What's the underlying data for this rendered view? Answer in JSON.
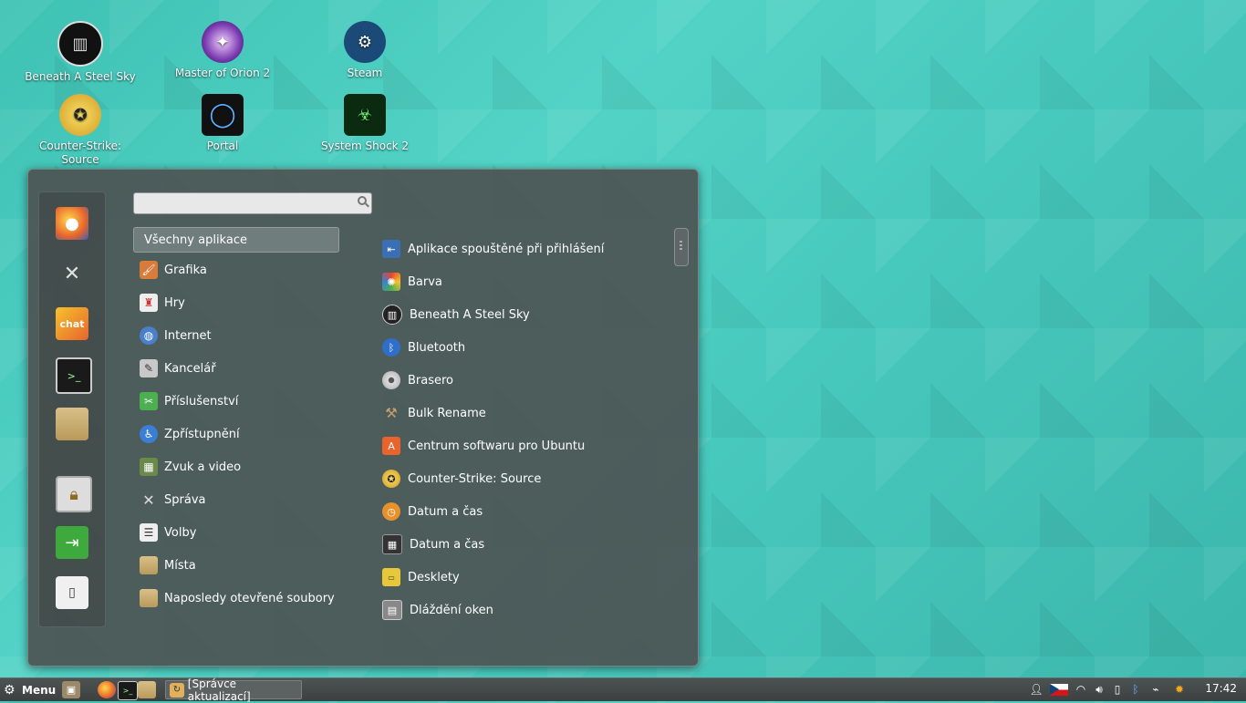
{
  "desktop_icons": [
    {
      "label": "Beneath A Steel Sky",
      "icon": "skyline-icon"
    },
    {
      "label": "Master of Orion 2",
      "icon": "planet-icon"
    },
    {
      "label": "Steam",
      "icon": "steam-icon"
    },
    {
      "label": "Counter-Strike: Source",
      "icon": "soldier-icon"
    },
    {
      "label": "Portal",
      "icon": "portal-icon"
    },
    {
      "label": "System Shock 2",
      "icon": "shodan-face-icon"
    }
  ],
  "favorites": [
    {
      "name": "Firefox",
      "icon": "firefox-icon"
    },
    {
      "name": "Settings",
      "icon": "tools-icon"
    },
    {
      "name": "Chat",
      "icon": "chat-icon"
    },
    {
      "name": "Terminal",
      "icon": "terminal-icon"
    },
    {
      "name": "Files",
      "icon": "folder-icon"
    },
    {
      "name": "Lock screen",
      "icon": "lock-screen-icon"
    },
    {
      "name": "Log out",
      "icon": "exit-icon"
    },
    {
      "name": "Shut down",
      "icon": "power-switch-icon"
    }
  ],
  "search": {
    "placeholder": "",
    "value": ""
  },
  "categories": [
    {
      "label": "Všechny aplikace",
      "selected": true
    },
    {
      "label": "Grafika",
      "icon": "graphics-icon"
    },
    {
      "label": "Hry",
      "icon": "games-icon"
    },
    {
      "label": "Internet",
      "icon": "globe-icon"
    },
    {
      "label": "Kancelář",
      "icon": "office-icon"
    },
    {
      "label": "Příslušenství",
      "icon": "accessories-icon"
    },
    {
      "label": "Zpřístupnění",
      "icon": "accessibility-icon"
    },
    {
      "label": "Zvuk a video",
      "icon": "film-icon"
    },
    {
      "label": "Správa",
      "icon": "admin-tools-icon"
    },
    {
      "label": "Volby",
      "icon": "preferences-icon"
    },
    {
      "label": "Místa",
      "icon": "folder-icon"
    },
    {
      "label": "Naposledy otevřené soubory",
      "icon": "recent-folder-icon"
    }
  ],
  "apps": [
    {
      "label": "Aplikace spouštěné při přihlášení",
      "icon": "startup-apps-icon",
      "color": "#3a6fb5"
    },
    {
      "label": "Barva",
      "icon": "color-icon",
      "color": "#e07a2e"
    },
    {
      "label": "Beneath A Steel Sky",
      "icon": "skyline-icon",
      "color": "#222222"
    },
    {
      "label": "Bluetooth",
      "icon": "bluetooth-icon",
      "color": "#2f6fc9"
    },
    {
      "label": "Brasero",
      "icon": "disc-icon",
      "color": "#c9c9c9"
    },
    {
      "label": "Bulk Rename",
      "icon": "rename-icon",
      "color": "#8a6a4a"
    },
    {
      "label": "Centrum softwaru pro Ubuntu",
      "icon": "software-center-icon",
      "color": "#e8642c"
    },
    {
      "label": "Counter-Strike: Source",
      "icon": "soldier-icon",
      "color": "#e8b83a"
    },
    {
      "label": "Datum a čas",
      "icon": "clock-icon",
      "color": "#e8902c"
    },
    {
      "label": "Datum a čas",
      "icon": "calendar-icon",
      "color": "#333333"
    },
    {
      "label": "Desklety",
      "icon": "desklets-icon",
      "color": "#e8c83a"
    },
    {
      "label": "Dláždění oken",
      "icon": "window-tiling-icon",
      "color": "#888888"
    }
  ],
  "panel": {
    "menu_label": "Menu",
    "launchers": [
      "files-icon",
      "firefox-icon",
      "terminal-icon",
      "folder-icon"
    ],
    "task_label": "[Správce aktualizací]",
    "tray": [
      "user-icon",
      "flag-cz-icon",
      "wifi-icon",
      "volume-icon",
      "battery-icon",
      "bluetooth-icon",
      "network-icon",
      "weather-icon"
    ],
    "clock": "17:42"
  }
}
